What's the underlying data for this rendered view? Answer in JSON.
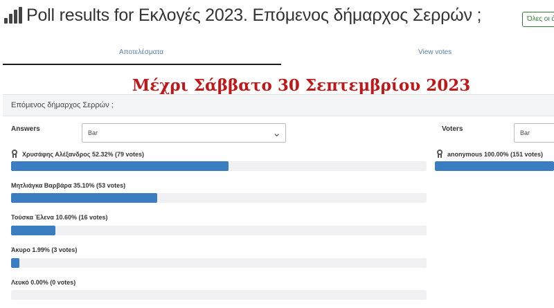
{
  "header": {
    "title": "Poll results for Εκλογές 2023. Επόμενος δήμαρχος Σερρών ;",
    "badge": "Όλες οι ά"
  },
  "tabs": [
    {
      "label": "Αποτελέσματα",
      "active": true
    },
    {
      "label": "View votes",
      "active": false
    }
  ],
  "banner": "Μέχρι Σάββατο 30 Σεπτεμβρίου 2023",
  "question": "Επόμενος δήμαρχος Σερρών ;",
  "answers_panel": {
    "heading": "Answers",
    "chart_type": "Bar",
    "items": [
      {
        "label": "Χρυσάφης Αλέξανδρος 52.32% (79 votes)",
        "percent": 52.32,
        "winner": true
      },
      {
        "label": "Μητλιάγκα Βαρβάρα 35.10% (53 votes)",
        "percent": 35.1,
        "winner": false
      },
      {
        "label": "Τούσκα Έλενα 10.60% (16 votes)",
        "percent": 10.6,
        "winner": false
      },
      {
        "label": "Άκυρο 1.99% (3 votes)",
        "percent": 1.99,
        "winner": false
      },
      {
        "label": "Λευκό 0.00% (0 votes)",
        "percent": 0.0,
        "winner": false
      }
    ]
  },
  "voters_panel": {
    "heading": "Voters",
    "chart_type": "Bar",
    "items": [
      {
        "label": "anonymous  100.00% (151 votes)",
        "percent": 100.0,
        "winner": true
      }
    ]
  },
  "colors": {
    "bar_fill": "#3a7ec1",
    "banner_text": "#c01818",
    "badge_border": "#2e7d32"
  }
}
